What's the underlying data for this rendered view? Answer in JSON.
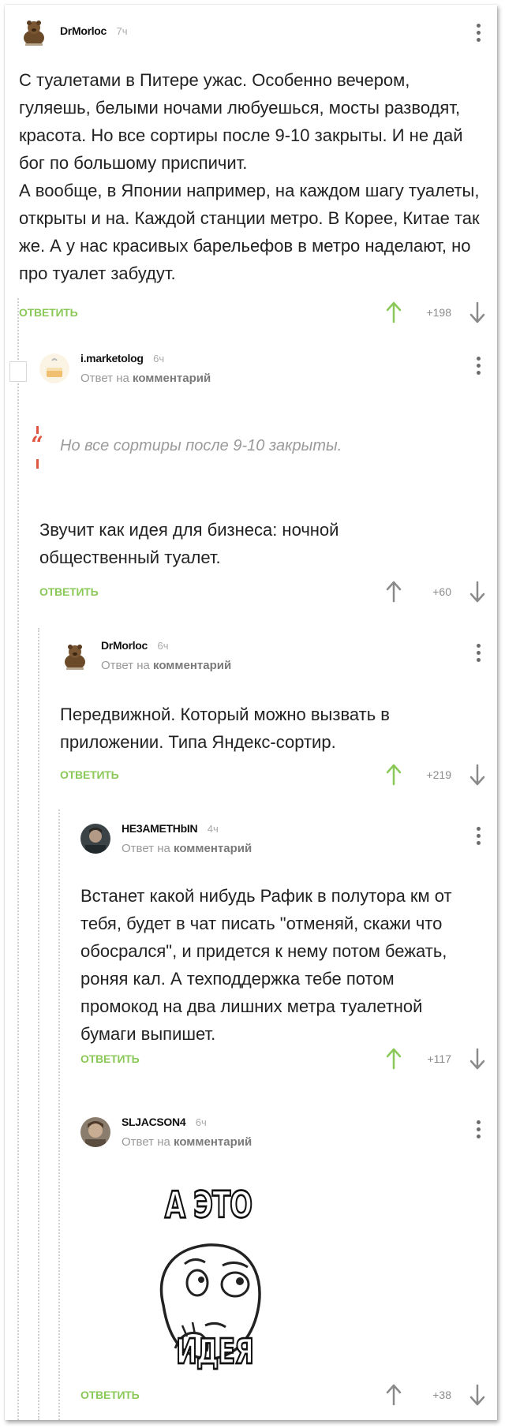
{
  "comments": [
    {
      "author": "DrMorloc",
      "time": "7ч",
      "text": "С туалетами в Питере ужас. Особенно вечером, гуляешь, белыми ночами любуешься, мосты разводят, красота. Но все сортиры после 9-10 закрыты. И не дай бог по большому приспичит.\nА вообще, в Японии например, на каждом шагу туалеты, открыты и на. Каждой станции метро. В Корее, Китае так же. А у нас красивых барельефов в метро наделают, но про туалет забудут.",
      "reply_label": "ОТВЕТИТЬ",
      "score": "+198",
      "avatar_icon": "bear-avatar"
    },
    {
      "author": "i.marketolog",
      "time": "6ч",
      "reply_prefix": "Ответ на",
      "reply_target": "комментарий",
      "quote": "Но все сортиры после 9-10 закрыты.",
      "text": "Звучит как идея для бизнеса: ночной общественный туалет.",
      "reply_label": "ОТВЕТИТЬ",
      "score": "+60",
      "avatar_icon": "cake-avatar"
    },
    {
      "author": "DrMorloc",
      "time": "6ч",
      "reply_prefix": "Ответ на",
      "reply_target": "комментарий",
      "text": "Передвижной. Который можно вызвать в приложении. Типа Яндекс-сортир.",
      "reply_label": "ОТВЕТИТЬ",
      "score": "+219",
      "avatar_icon": "bear-avatar"
    },
    {
      "author": "HE3AMETHbIN",
      "time": "4ч",
      "reply_prefix": "Ответ на",
      "reply_target": "комментарий",
      "text": "Встанет какой нибудь Рафик в полутора км от тебя, будет в чат писать \"отменяй, скажи что обосрался\", и придется к нему потом бежать, роняя кал. А техподдержка тебе потом промокод на два лишних метра туалетной бумаги выпишет.",
      "reply_label": "ОТВЕТИТЬ",
      "score": "+117",
      "avatar_icon": "person-photo-avatar"
    },
    {
      "author": "SLJACSON4",
      "time": "6ч",
      "reply_prefix": "Ответ на",
      "reply_target": "комментарий",
      "meme_top": "А ЭТО",
      "meme_bottom": "ИДЕЯ",
      "reply_label": "ОТВЕТИТЬ",
      "score": "+38",
      "avatar_icon": "person-photo-avatar"
    }
  ],
  "colors": {
    "reply": "#8ac858",
    "upvote": "#8ac858",
    "downvote": "#8a8a8a",
    "quote_bar": "#e05640"
  }
}
